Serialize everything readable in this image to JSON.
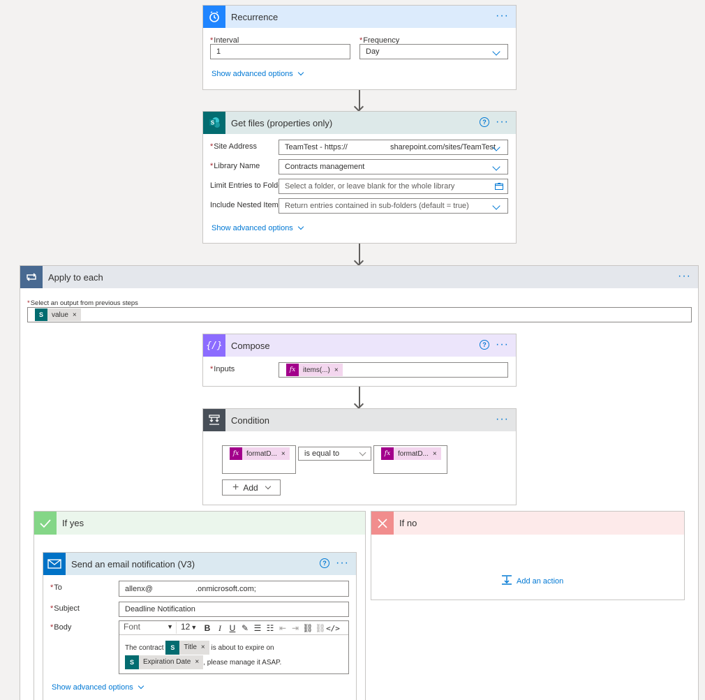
{
  "recurrence": {
    "title": "Recurrence",
    "interval_label": "Interval",
    "interval_value": "1",
    "frequency_label": "Frequency",
    "frequency_value": "Day",
    "advanced": "Show advanced options"
  },
  "getfiles": {
    "title": "Get files (properties only)",
    "site_label": "Site Address",
    "site_value": "TeamTest - https://                    sharepoint.com/sites/TeamTest",
    "library_label": "Library Name",
    "library_value": "Contracts management",
    "folder_label": "Limit Entries to Folder",
    "folder_placeholder": "Select a folder, or leave blank for the whole library",
    "nested_label": "Include Nested Items",
    "nested_value": "Return entries contained in sub-folders (default = true)",
    "advanced": "Show advanced options"
  },
  "apply": {
    "title": "Apply to each",
    "select_label": "Select an output from previous steps",
    "token": "value"
  },
  "compose": {
    "title": "Compose",
    "inputs_label": "Inputs",
    "token": "items(...)"
  },
  "condition": {
    "title": "Condition",
    "left_token": "formatD...",
    "operator": "is equal to",
    "right_token": "formatD...",
    "add_label": "Add"
  },
  "if_yes": {
    "title": "If yes"
  },
  "if_no": {
    "title": "If no",
    "add_action": "Add an action"
  },
  "email": {
    "title": "Send an email notification (V3)",
    "to_label": "To",
    "to_value": "allenx@                    .onmicrosoft.com;",
    "subject_label": "Subject",
    "subject_value": "Deadline Notification",
    "body_label": "Body",
    "font": "Font",
    "font_size": "12",
    "body_text_1": "The contract",
    "title_token": "Title",
    "body_text_2": "is about to expire on",
    "date_token": "Expiration Date",
    "body_text_3": ", please manage it ASAP.",
    "advanced": "Show advanced options"
  },
  "required_mark": "*",
  "colors": {
    "recurrence": "#1f85ff",
    "sharepoint": "#036c70",
    "apply": "#486991",
    "compose": "#8c6cff",
    "condition": "#484f58",
    "yes": "#84d687",
    "no": "#f18d8d",
    "mail": "#0072c6",
    "link": "#0078d4"
  }
}
